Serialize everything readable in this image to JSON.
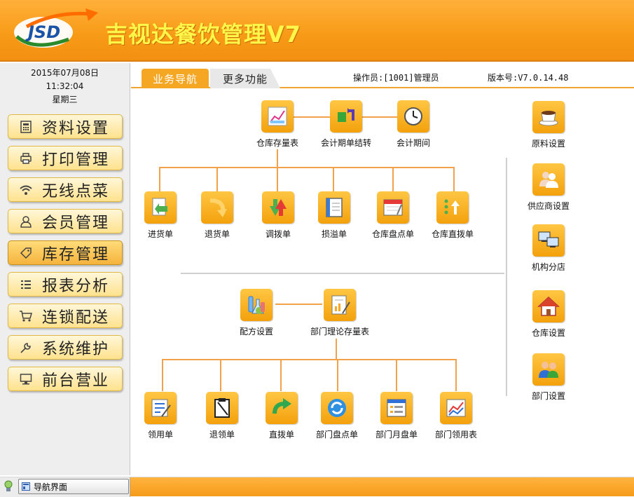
{
  "app": {
    "title": "吉视达餐饮管理V7",
    "logo_text": "JSD"
  },
  "sidebar": {
    "date": "2015年07月08日",
    "time": "11:32:04",
    "weekday": "星期三",
    "items": [
      {
        "label": "资料设置",
        "icon": "calculator-icon"
      },
      {
        "label": "打印管理",
        "icon": "printer-icon"
      },
      {
        "label": "无线点菜",
        "icon": "wifi-icon"
      },
      {
        "label": "会员管理",
        "icon": "user-icon"
      },
      {
        "label": "库存管理",
        "icon": "tag-icon",
        "active": true
      },
      {
        "label": "报表分析",
        "icon": "list-icon"
      },
      {
        "label": "连锁配送",
        "icon": "cart-icon"
      },
      {
        "label": "系统维护",
        "icon": "wrench-icon"
      },
      {
        "label": "前台营业",
        "icon": "monitor-icon"
      }
    ]
  },
  "tabs": [
    {
      "label": "业务导航",
      "active": true
    },
    {
      "label": "更多功能"
    }
  ],
  "operator": "操作员:[1001]管理员",
  "version": "版本号:V7.0.14.48",
  "nodes": {
    "top": [
      "仓库存量表",
      "会计期单结转",
      "会计期间"
    ],
    "row1": [
      "进货单",
      "退货单",
      "调拨单",
      "损溢单",
      "仓库盘点单",
      "仓库直拨单"
    ],
    "mid": [
      "配方设置",
      "部门理论存量表"
    ],
    "row2": [
      "领用单",
      "退领单",
      "直拨单",
      "部门盘点单",
      "部门月盘单",
      "部门领用表"
    ],
    "right": [
      "原料设置",
      "供应商设置",
      "机构分店",
      "仓库设置",
      "部门设置"
    ]
  },
  "statusbar": {
    "nav_label": "导航界面"
  },
  "colors": {
    "accent": "#f5a623",
    "title": "#fff64a",
    "connector": "#f2a24a"
  }
}
